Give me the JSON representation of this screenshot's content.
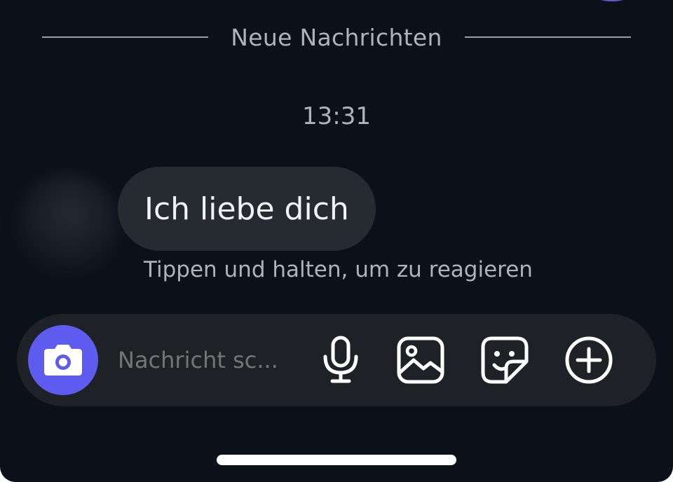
{
  "chat": {
    "divider_label": "Neue Nachrichten",
    "timestamp": "13:31",
    "message": {
      "text": "Ich liebe dich"
    },
    "reaction_hint": "Tippen und halten, um zu reagieren"
  },
  "composer": {
    "placeholder": "Nachricht sc...",
    "camera_icon": "camera-icon",
    "tools": [
      {
        "icon": "microphone-icon"
      },
      {
        "icon": "image-icon"
      },
      {
        "icon": "sticker-icon"
      },
      {
        "icon": "plus-circle-icon"
      }
    ]
  },
  "colors": {
    "background": "#0c1019",
    "bubble": "#262a31",
    "composer": "#1e2227",
    "accent": "#5d5cee",
    "muted_text": "#aeb3bc"
  }
}
